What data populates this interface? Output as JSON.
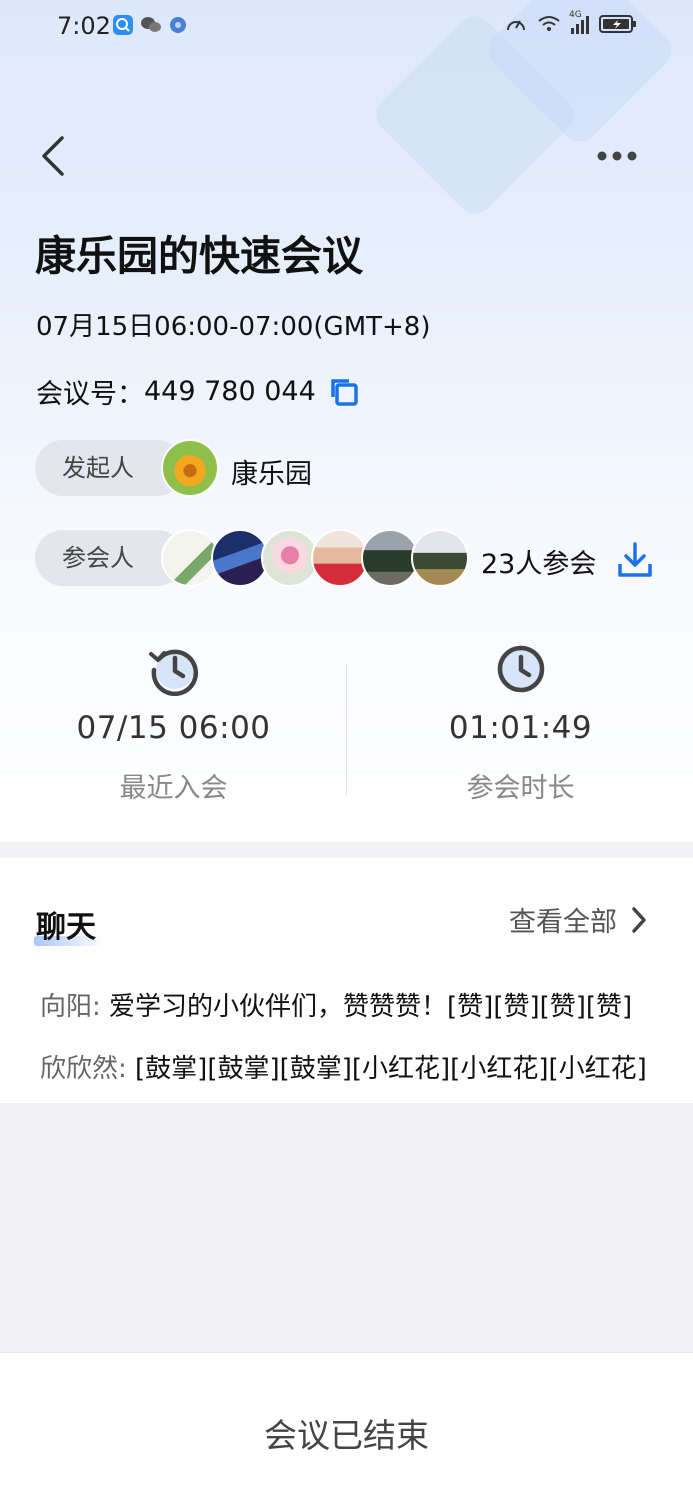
{
  "status_bar": {
    "time": "7:02",
    "network": "4G",
    "icons": [
      "search-app-icon",
      "wechat-icon",
      "browser-icon",
      "speed-icon",
      "wifi-icon",
      "signal-icon",
      "battery-icon"
    ]
  },
  "header": {
    "back_icon": "chevron-left-icon",
    "more_icon": "more-dots-icon"
  },
  "meeting": {
    "title": "康乐园的快速会议",
    "time_range": "07月15日06:00-07:00(GMT+8)",
    "number_label": "会议号：",
    "number": "449 780 044"
  },
  "initiator": {
    "label": "发起人",
    "name": "康乐园"
  },
  "attendees": {
    "label": "参会人",
    "count_text": "23人参会",
    "avatars_visible": 6
  },
  "stats": {
    "recent_join_value": "07/15 06:00",
    "recent_join_label": "最近入会",
    "duration_value": "01:01:49",
    "duration_label": "参会时长"
  },
  "chat": {
    "title": "聊天",
    "view_all": "查看全部",
    "messages": [
      {
        "sender": "向阳: ",
        "text": "爱学习的小伙伴们，赞赞赞！[赞][赞][赞][赞]"
      },
      {
        "sender": "欣欣然: ",
        "text": "[鼓掌][鼓掌][鼓掌][小红花][小红花][小红花]"
      }
    ]
  },
  "footer": {
    "status": "会议已结束"
  },
  "colors": {
    "accent": "#1a73e8",
    "pill_bg": "#e3e6ec",
    "gradient_top": "#dde8fb"
  }
}
